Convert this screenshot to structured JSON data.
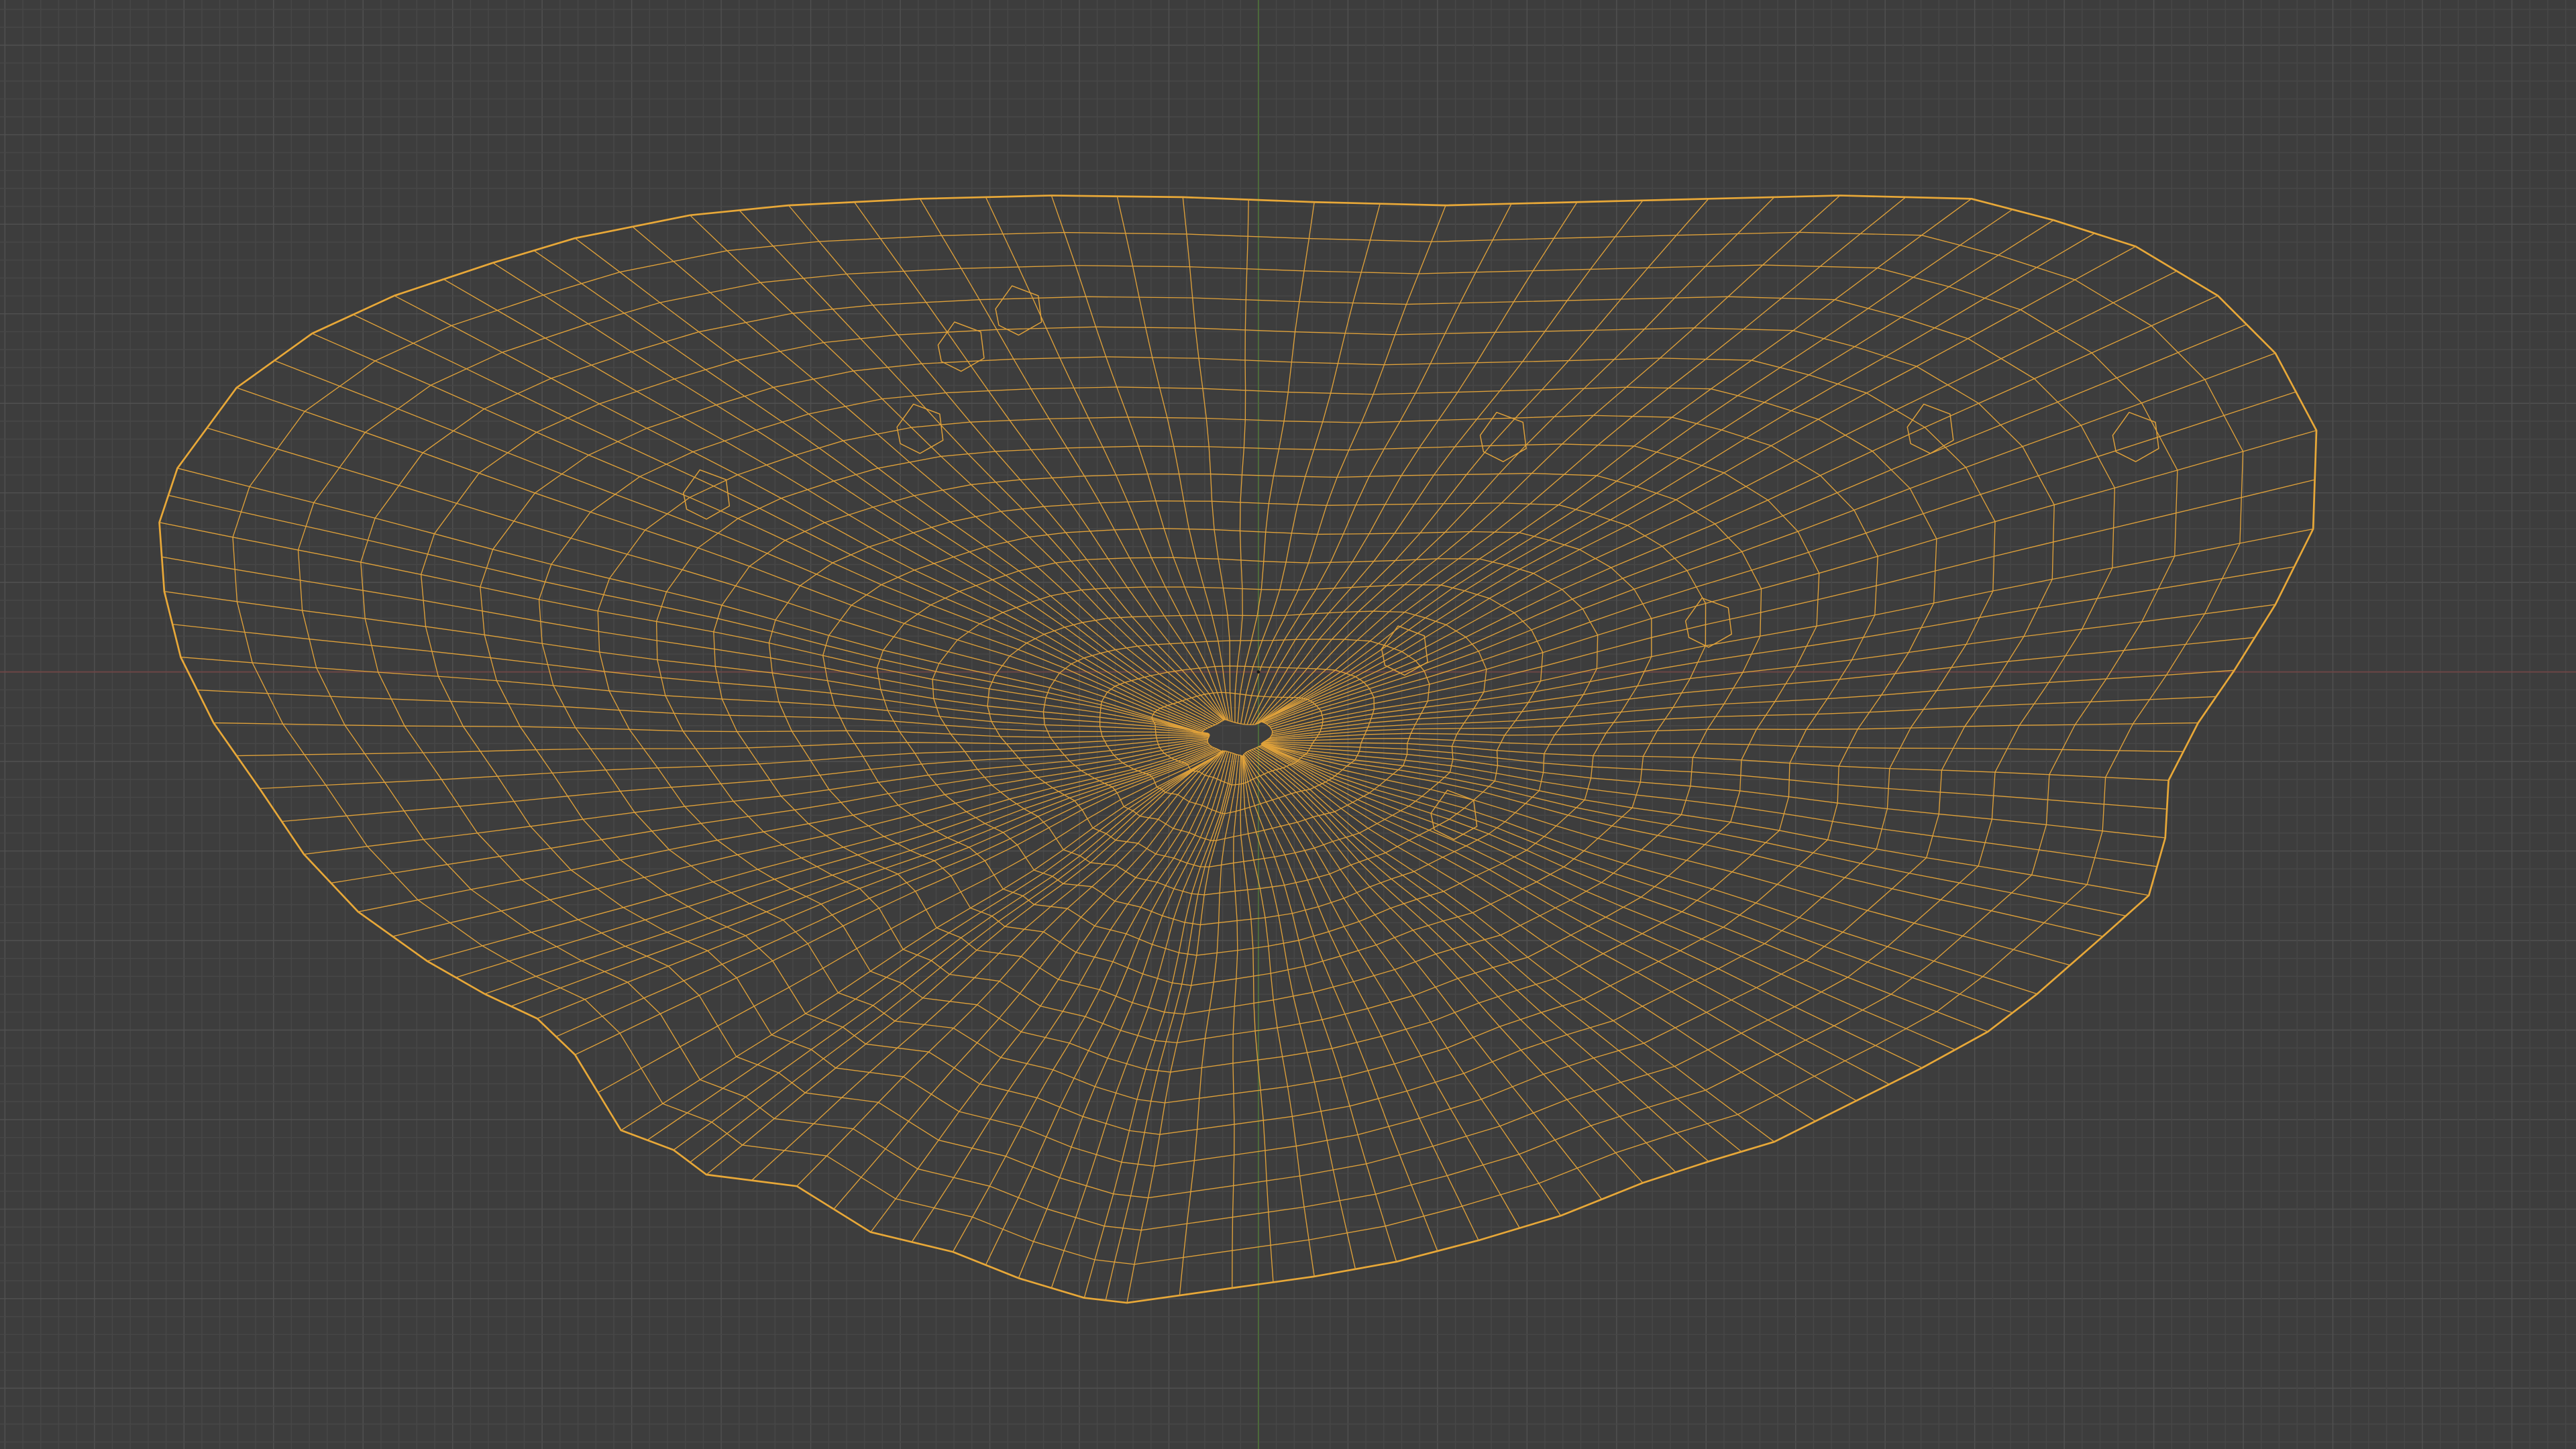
{
  "viewport": {
    "background_color": "#3d3d3d",
    "grid": {
      "minor_color": "#474747",
      "major_color": "#505050",
      "x_axis_color": "#6b4646",
      "y_axis_color": "#4c6b3a"
    }
  },
  "mesh": {
    "state": "selected",
    "wire_color": "#dfa13a",
    "edge_color": "#e8a838"
  },
  "scene": {
    "origin_marker": "object-origin-dot"
  }
}
